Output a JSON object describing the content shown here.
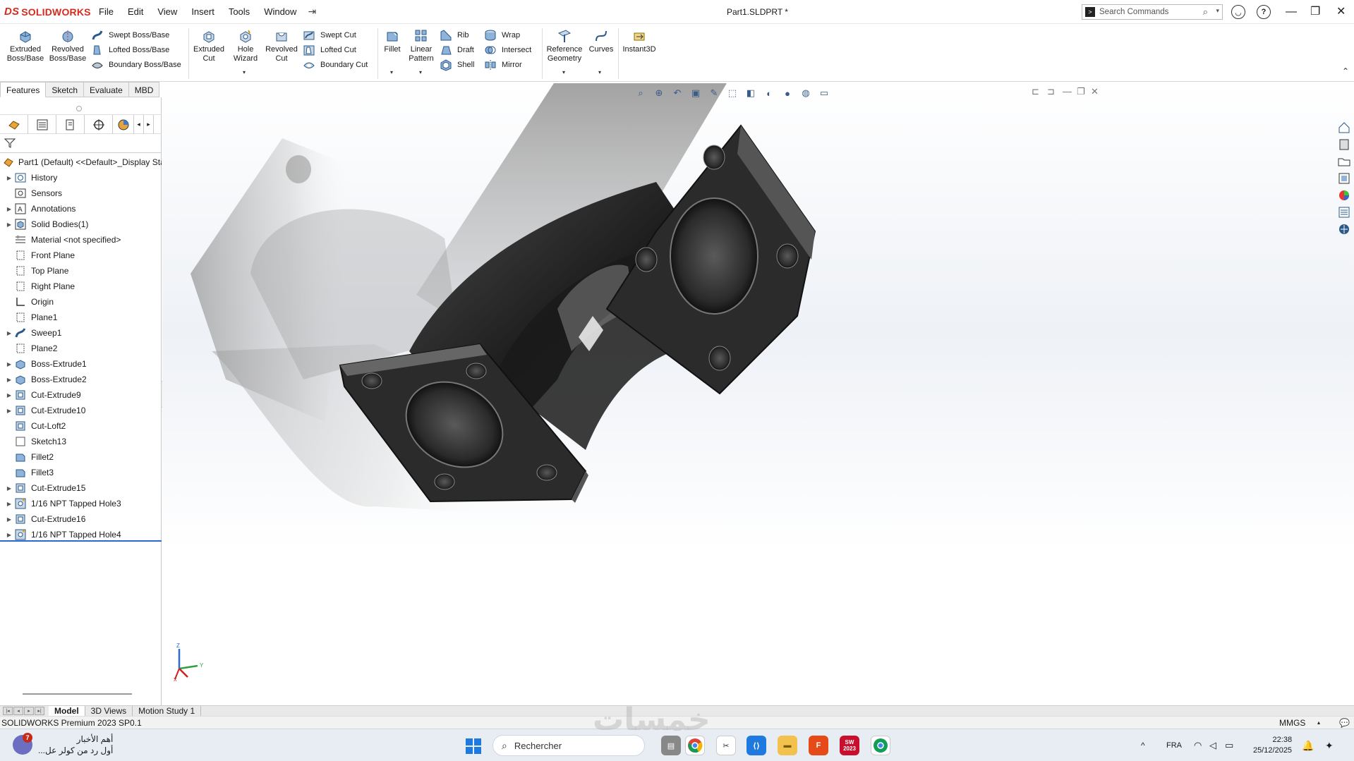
{
  "app": {
    "logo_text": "SOLIDWORKS",
    "menus": [
      "File",
      "Edit",
      "View",
      "Insert",
      "Tools",
      "Window"
    ],
    "document_title": "Part1.SLDPRT *",
    "search_placeholder": "Search Commands"
  },
  "ribbon": {
    "extruded_boss": [
      "Extruded",
      "Boss/Base"
    ],
    "revolved_boss": [
      "Revolved",
      "Boss/Base"
    ],
    "swept_boss": "Swept Boss/Base",
    "lofted_boss": "Lofted Boss/Base",
    "boundary_boss": "Boundary Boss/Base",
    "extruded_cut": [
      "Extruded",
      "Cut"
    ],
    "hole_wizard": [
      "Hole",
      "Wizard"
    ],
    "revolved_cut": [
      "Revolved",
      "Cut"
    ],
    "swept_cut": "Swept Cut",
    "lofted_cut": "Lofted Cut",
    "boundary_cut": "Boundary Cut",
    "fillet": "Fillet",
    "linear_pattern": [
      "Linear",
      "Pattern"
    ],
    "rib": "Rib",
    "draft": "Draft",
    "shell": "Shell",
    "wrap": "Wrap",
    "intersect": "Intersect",
    "mirror": "Mirror",
    "reference_geometry": [
      "Reference",
      "Geometry"
    ],
    "curves": "Curves",
    "instant3d": "Instant3D"
  },
  "command_tabs": [
    "Features",
    "Sketch",
    "Evaluate",
    "MBD"
  ],
  "tree": {
    "root": "Part1 (Default) <<Default>_Display Sta",
    "items": [
      {
        "label": "History",
        "expand": true,
        "icon": "history-icon"
      },
      {
        "label": "Sensors",
        "expand": false,
        "icon": "sensor-icon"
      },
      {
        "label": "Annotations",
        "expand": true,
        "icon": "annotation-icon"
      },
      {
        "label": "Solid Bodies(1)",
        "expand": true,
        "icon": "solid-body-icon"
      },
      {
        "label": "Material <not specified>",
        "expand": false,
        "icon": "material-icon"
      },
      {
        "label": "Front Plane",
        "expand": false,
        "icon": "plane-icon"
      },
      {
        "label": "Top Plane",
        "expand": false,
        "icon": "plane-icon"
      },
      {
        "label": "Right Plane",
        "expand": false,
        "icon": "plane-icon"
      },
      {
        "label": "Origin",
        "expand": false,
        "icon": "origin-icon"
      },
      {
        "label": "Plane1",
        "expand": false,
        "icon": "plane-icon"
      },
      {
        "label": "Sweep1",
        "expand": true,
        "icon": "sweep-icon"
      },
      {
        "label": "Plane2",
        "expand": false,
        "icon": "plane-icon"
      },
      {
        "label": "Boss-Extrude1",
        "expand": true,
        "icon": "extrude-icon"
      },
      {
        "label": "Boss-Extrude2",
        "expand": true,
        "icon": "extrude-icon"
      },
      {
        "label": "Cut-Extrude9",
        "expand": true,
        "icon": "cut-icon"
      },
      {
        "label": "Cut-Extrude10",
        "expand": true,
        "icon": "cut-icon"
      },
      {
        "label": "Cut-Loft2",
        "expand": false,
        "icon": "cut-icon"
      },
      {
        "label": "Sketch13",
        "expand": false,
        "icon": "sketch-icon"
      },
      {
        "label": "Fillet2",
        "expand": false,
        "icon": "fillet-icon"
      },
      {
        "label": "Fillet3",
        "expand": false,
        "icon": "fillet-icon"
      },
      {
        "label": "Cut-Extrude15",
        "expand": true,
        "icon": "cut-icon"
      },
      {
        "label": "1/16 NPT Tapped Hole3",
        "expand": true,
        "icon": "hole-icon"
      },
      {
        "label": "Cut-Extrude16",
        "expand": true,
        "icon": "cut-icon"
      },
      {
        "label": "1/16 NPT Tapped Hole4",
        "expand": true,
        "icon": "hole-icon"
      }
    ]
  },
  "viewport": {
    "triad": {
      "x": "X",
      "y": "Y",
      "z": "Z"
    }
  },
  "bottom_tabs": [
    "Model",
    "3D Views",
    "Motion Study 1"
  ],
  "status": {
    "version": "SOLIDWORKS Premium 2023 SP0.1",
    "units": "MMGS"
  },
  "taskbar": {
    "news_badge": "7",
    "news_title": "أهم الأخبار",
    "news_sub": "أول رد من كولر عل...",
    "search_placeholder": "Rechercher",
    "solidworks_year": "2023",
    "lang": "FRA",
    "time": "22:38",
    "date": "25/12/2025"
  },
  "watermark": "خمسات",
  "colors": {
    "brand_red": "#d52b1e",
    "accent_blue": "#2a6ad0",
    "part_dark": "#2b2b2b"
  }
}
